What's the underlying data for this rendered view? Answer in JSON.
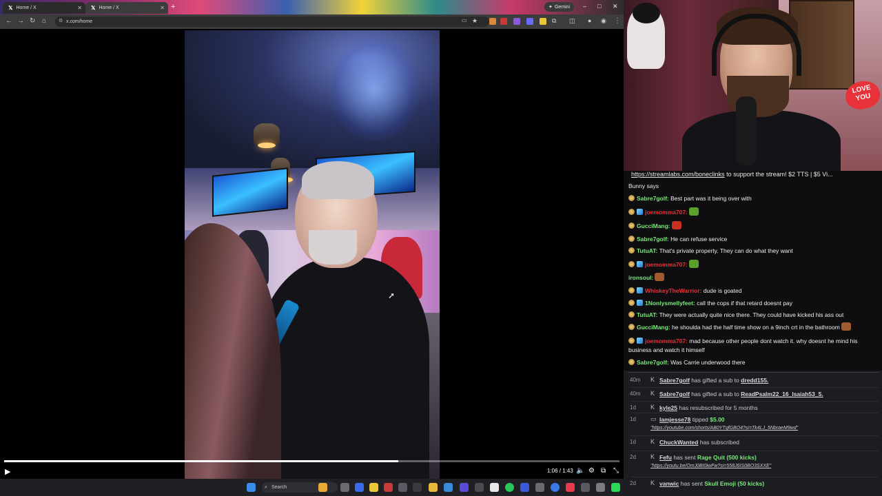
{
  "browser": {
    "tabs": [
      {
        "title": "Home / X",
        "active": false
      },
      {
        "title": "Home / X",
        "active": true
      }
    ],
    "new_tab": "+",
    "gemini_label": "Gemini",
    "url": "x.com/home",
    "window_controls": {
      "minimize": "–",
      "maximize": "□",
      "close": "✕"
    }
  },
  "video": {
    "current_time": "1:06",
    "duration": "1:43",
    "time_display": "1:06 / 1:43",
    "progress_fraction": 0.64
  },
  "taskbar": {
    "search_placeholder": "Search"
  },
  "chat": {
    "top_line": {
      "link": "https://streamlabs.com/boneclinks",
      "rest": " to support the stream! $2 TTS | $5 Vi..."
    },
    "messages": [
      {
        "user": "",
        "text": "Bunny says",
        "badges": [],
        "user_color": "#efeff1"
      },
      {
        "user": "Sabre7golf:",
        "text": "Best part was it being over with",
        "badges": [
          "gold"
        ],
        "user_color": "#7be87a"
      },
      {
        "user": "joemomma707:",
        "text": "",
        "badges": [
          "gold",
          "blue"
        ],
        "user_color": "#e8323a",
        "emote": "#5aa02a"
      },
      {
        "user": "GucciMang:",
        "text": "",
        "badges": [
          "gold"
        ],
        "user_color": "#7be87a",
        "emote": "#c83020"
      },
      {
        "user": "Sabre7golf:",
        "text": "He can refuse service",
        "badges": [
          "gold"
        ],
        "user_color": "#7be87a"
      },
      {
        "user": "TutuAT:",
        "text": "That's private property. They can do what they want",
        "badges": [
          "gold"
        ],
        "user_color": "#7be87a"
      },
      {
        "user": "joemomma707:",
        "text": "",
        "badges": [
          "gold",
          "blue"
        ],
        "user_color": "#e8323a",
        "emote": "#5aa02a"
      },
      {
        "user": "ironsoul:",
        "text": "",
        "badges": [],
        "user_color": "#7be87a",
        "emote": "#a05a30"
      },
      {
        "user": "WhiskeyTheWarrior:",
        "text": "dude is goated",
        "badges": [
          "gold",
          "blue"
        ],
        "user_color": "#e8323a"
      },
      {
        "user": "1Nonlysmellyfeet:",
        "text": "call the cops if that retard doesnt pay",
        "badges": [
          "gold",
          "blue"
        ],
        "user_color": "#7be87a"
      },
      {
        "user": "TutuAT:",
        "text": "They were actually quite nice there. They could have kicked his ass out",
        "badges": [
          "gold"
        ],
        "user_color": "#7be87a"
      },
      {
        "user": "GucciMang:",
        "text": "he shoulda had the half time show on a 9inch crt in the bathroom",
        "badges": [
          "gold"
        ],
        "user_color": "#7be87a",
        "emote": "#a05a30"
      },
      {
        "user": "joemomma707:",
        "text": "mad because other people dont watch it. why doesnt he mind his business and watch it himself",
        "badges": [
          "gold",
          "blue"
        ],
        "user_color": "#e8323a"
      },
      {
        "user": "Sabre7golf:",
        "text": "Was Carrie underwood there",
        "badges": [
          "gold"
        ],
        "user_color": "#7be87a"
      }
    ]
  },
  "events": [
    {
      "ago": "40m",
      "icon": "kick",
      "user": "Sabre7golf",
      "text": " has gifted a sub to ",
      "target": "dredd155."
    },
    {
      "ago": "40m",
      "icon": "kick",
      "user": "Sabre7golf",
      "text": " has gifted a sub to ",
      "target": "ReadPsalm22_16_Isaiah53_5."
    },
    {
      "ago": "1d",
      "icon": "kick",
      "user": "kyle25",
      "text": " has resubscribed for 5 months",
      "target": ""
    },
    {
      "ago": "1d",
      "icon": "tip",
      "user": "Iamjesse78",
      "text": " tipped ",
      "highlight": "$5.00",
      "note": "\"https://youtube.com/shorts/AB0YTqfGBO4?si=Tk4LJ_5NbraeM9wd\""
    },
    {
      "ago": "1d",
      "icon": "kick",
      "user": "ChuckWanted",
      "text": " has subscribed",
      "target": ""
    },
    {
      "ago": "2d",
      "icon": "kick",
      "user": "Fefu",
      "text": " has sent ",
      "highlight": "Rage Quit (500 kicks)",
      "note": "\"https://youtu.be/OmJ0BI0iwFw?si=558J6IS0BO3SXXE\""
    },
    {
      "ago": "2d",
      "icon": "kick",
      "user": "vanwic",
      "text": " has sent ",
      "highlight": "Skull Emoji (50 kicks)"
    }
  ]
}
